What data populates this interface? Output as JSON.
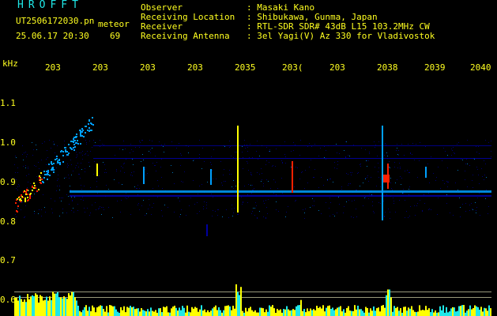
{
  "header": {
    "brand": "HROFFT",
    "filename": "UT2506172030.png",
    "filename_display": "UT2506172030.pn",
    "mode_label": "meteor",
    "datetime": "25.06.17 20:30",
    "count": "69"
  },
  "info": [
    {
      "key": "Observer",
      "value": ": Masaki Kano"
    },
    {
      "key": "Receiving Location",
      "value": ": Shibukawa, Gunma, Japan"
    },
    {
      "key": "Receiver",
      "value": ": RTL-SDR SDR# 43dB L15 103.2MHz CW"
    },
    {
      "key": "Receiving Antenna",
      "value": ": 3el Yagi(V) Az 330 for Vladivostok"
    }
  ],
  "axis": {
    "y_unit": "kHz",
    "y_ticks": [
      "1.1",
      "1.0",
      "0.9",
      "0.8",
      "0.7",
      "0.6"
    ],
    "x_ticks": [
      "203",
      "203",
      "203",
      "203",
      "2035",
      "203(",
      "203",
      "2038",
      "2039",
      "2040"
    ]
  },
  "colors": {
    "background": "#000000",
    "text_yellow": "#ffff20",
    "text_cyan": "#1fe8e8",
    "signal_low": "#0000a0",
    "signal_mid": "#00a0ff",
    "signal_high": "#ffff00",
    "signal_peak": "#ff2000"
  }
}
